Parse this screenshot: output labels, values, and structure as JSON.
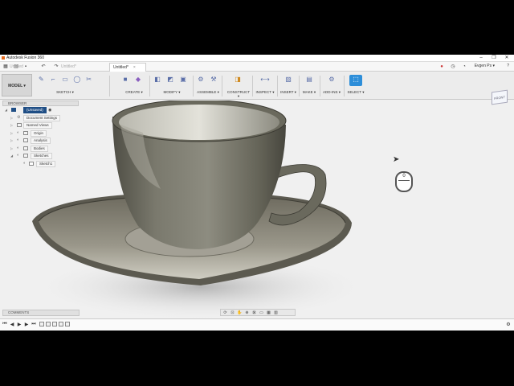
{
  "window": {
    "title": "Autodesk Fusion 360",
    "controls": [
      "–",
      "❐",
      "✕"
    ]
  },
  "tabs": [
    {
      "label": "Untitled",
      "active": false
    },
    {
      "label": "Untitled*",
      "active": false
    },
    {
      "label": "Untitled*",
      "active": true
    }
  ],
  "user": {
    "name": "Evgen Ps ▾",
    "help": "?"
  },
  "toolbar": {
    "workspace": "MODEL ▾",
    "groups": [
      {
        "label": "SKETCH ▾",
        "icons": [
          "sketch-icon",
          "line-icon",
          "rectangle-icon",
          "circle-icon",
          "trim-icon",
          "offset-icon"
        ]
      },
      {
        "label": "CREATE ▾",
        "icons": [
          "extrude-icon",
          "form-icon"
        ]
      },
      {
        "label": "MODIFY ▾",
        "icons": [
          "press-pull-icon",
          "fillet-icon",
          "shell-icon"
        ]
      },
      {
        "label": "ASSEMBLE ▾",
        "icons": [
          "joint-icon",
          "as-built-joint-icon"
        ]
      },
      {
        "label": "CONSTRUCT ▾",
        "icons": [
          "plane-icon"
        ]
      },
      {
        "label": "INSPECT ▾",
        "icons": [
          "measure-icon"
        ]
      },
      {
        "label": "INSERT ▾",
        "icons": [
          "insert-image-icon"
        ]
      },
      {
        "label": "MAKE ▾",
        "icons": [
          "3d-print-icon"
        ]
      },
      {
        "label": "ADD-INS ▾",
        "icons": [
          "scripts-icon"
        ]
      },
      {
        "label": "SELECT ▾",
        "icons": [
          "select-icon"
        ]
      }
    ]
  },
  "viewcube": {
    "label": "FRONT"
  },
  "browser": {
    "header": "BROWSER",
    "items": [
      {
        "label": "(Unsaved)",
        "indent": 0,
        "type": "root"
      },
      {
        "label": "Document Settings",
        "indent": 1,
        "type": "settings"
      },
      {
        "label": "Named Views",
        "indent": 1,
        "type": "folder"
      },
      {
        "label": "Origin",
        "indent": 1,
        "type": "folder"
      },
      {
        "label": "Analysis",
        "indent": 1,
        "type": "folder"
      },
      {
        "label": "Bodies",
        "indent": 1,
        "type": "folder"
      },
      {
        "label": "Sketches",
        "indent": 1,
        "type": "folder"
      },
      {
        "label": "Sketch1",
        "indent": 2,
        "type": "sketch"
      }
    ]
  },
  "comments": {
    "label": "COMMENTS"
  },
  "mouse_indicator": "0",
  "colors": {
    "accent": "#2d8ed9",
    "root": "#1f4e85",
    "cup": "#6f6e63"
  }
}
